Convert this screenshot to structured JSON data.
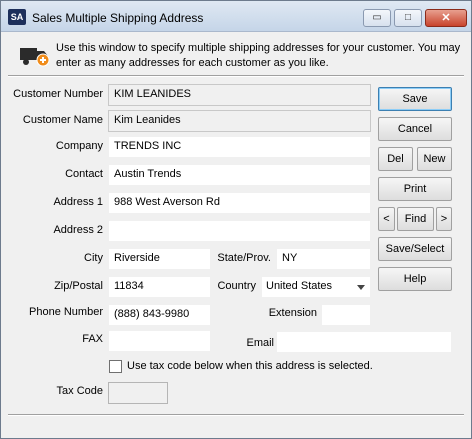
{
  "window": {
    "app_icon_text": "SA",
    "title": "Sales Multiple Shipping Address",
    "min_glyph": "▭",
    "max_glyph": "□",
    "close_glyph": "✕"
  },
  "info": {
    "icon": "truck-add-icon",
    "text": "Use this window to specify multiple shipping addresses for your customer. You may enter as many addresses for each customer as you like."
  },
  "form": {
    "customer_number": {
      "label": "Customer Number",
      "value": "KIM LEANIDES"
    },
    "customer_name": {
      "label": "Customer Name",
      "value": "Kim Leanides"
    },
    "company": {
      "label": "Company",
      "value": "TRENDS INC"
    },
    "contact": {
      "label": "Contact",
      "value": "Austin Trends"
    },
    "address1": {
      "label": "Address 1",
      "value": "988 West Averson Rd"
    },
    "address2": {
      "label": "Address 2",
      "value": ""
    },
    "city": {
      "label": "City",
      "value": "Riverside"
    },
    "state": {
      "label": "State/Prov.",
      "value": "NY"
    },
    "zip": {
      "label": "Zip/Postal",
      "value": "11834"
    },
    "country": {
      "label": "Country",
      "value": "United States"
    },
    "phone": {
      "label": "Phone Number",
      "value": "(888) 843-9980"
    },
    "extension": {
      "label": "Extension",
      "value": ""
    },
    "fax": {
      "label": "FAX",
      "value": ""
    },
    "email": {
      "label": "Email",
      "value": ""
    },
    "use_tax_code": {
      "label": "Use tax code below when this address is selected.",
      "checked": false
    },
    "tax_code": {
      "label": "Tax Code",
      "value": ""
    }
  },
  "buttons": {
    "save": "Save",
    "cancel": "Cancel",
    "del": "Del",
    "new": "New",
    "print": "Print",
    "prev": "<",
    "find": "Find",
    "next": ">",
    "save_select": "Save/Select",
    "help": "Help"
  }
}
